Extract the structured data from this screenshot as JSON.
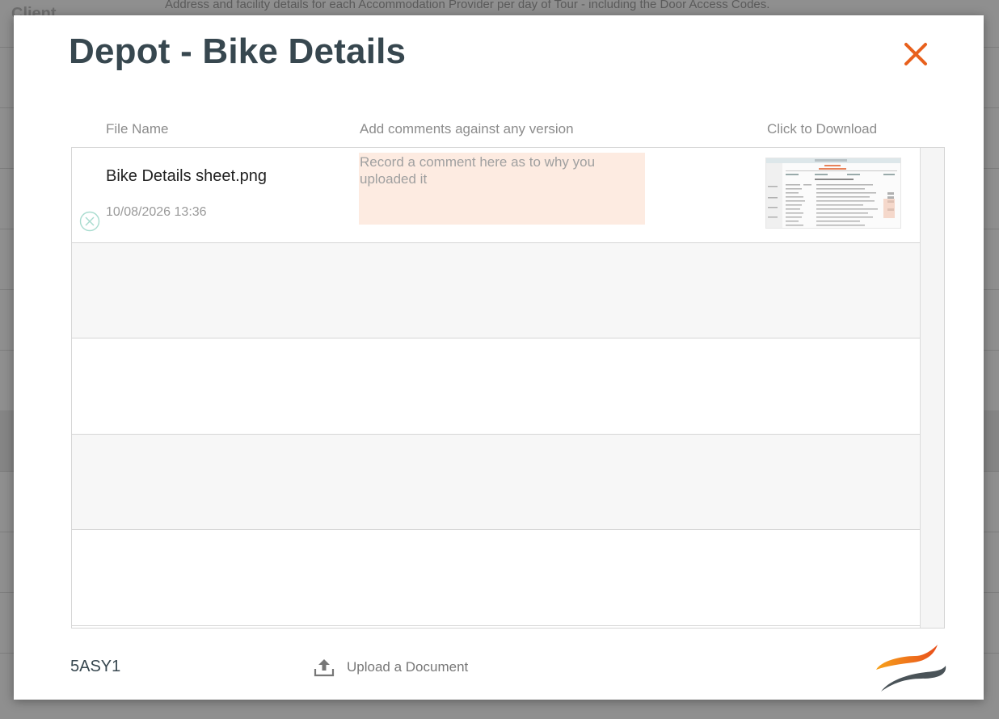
{
  "background": {
    "header_text": "Address and facility details for each Accommodation Provider per day of Tour - including the Door Access Codes.",
    "client_label": "Client"
  },
  "modal": {
    "title": "Depot - Bike Details",
    "close_icon": "close-icon",
    "columns": {
      "file_name": "File Name",
      "comments": "Add comments against any version",
      "download": "Click to Download"
    },
    "files": [
      {
        "name": "Bike Details sheet.png",
        "date": "10/08/2026 13:36",
        "comment_value": "",
        "comment_placeholder": "Record a comment here as to why you uploaded it"
      }
    ],
    "footer": {
      "code": "5ASY1",
      "upload_label": "Upload a Document",
      "upload_icon": "upload-icon"
    }
  },
  "colors": {
    "title": "#37474f",
    "close": "#e8601c",
    "comment_bg": "#fdebe1",
    "delete_icon": "#a8dccf"
  }
}
